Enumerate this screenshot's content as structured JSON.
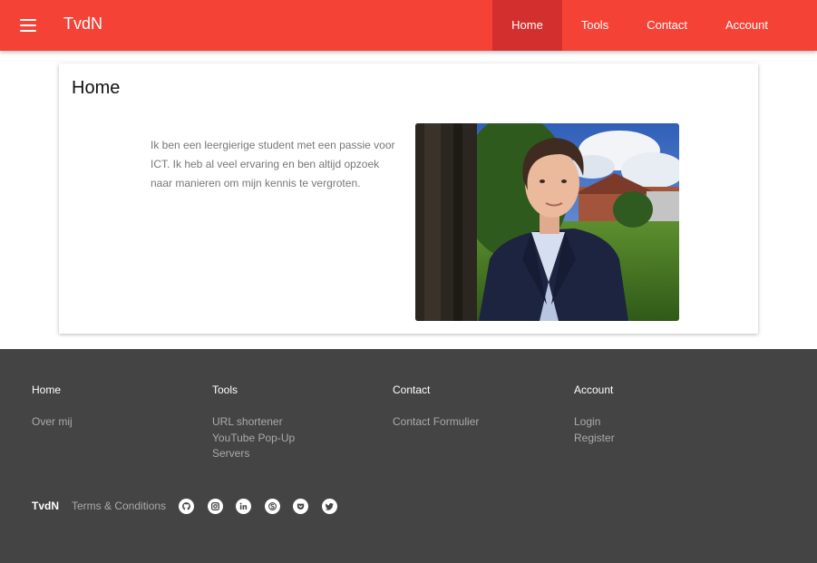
{
  "header": {
    "brand": "TvdN",
    "nav": [
      {
        "label": "Home",
        "active": true
      },
      {
        "label": "Tools",
        "active": false
      },
      {
        "label": "Contact",
        "active": false
      },
      {
        "label": "Account",
        "active": false
      }
    ]
  },
  "main": {
    "title": "Home",
    "intro": "Ik ben een leergierige student met een passie voor ICT. Ik heb al veel ervaring en ben altijd opzoek naar manieren om mijn kennis te vergroten."
  },
  "footer": {
    "columns": [
      {
        "heading": "Home",
        "links": [
          "Over mij"
        ]
      },
      {
        "heading": "Tools",
        "links": [
          "URL shortener",
          "YouTube Pop-Up",
          "Servers"
        ]
      },
      {
        "heading": "Contact",
        "links": [
          "Contact Formulier"
        ]
      },
      {
        "heading": "Account",
        "links": [
          "Login",
          "Register"
        ]
      }
    ],
    "brand": "TvdN",
    "terms": "Terms & Conditions",
    "social_icons": [
      "github-icon",
      "instagram-icon",
      "linkedin-icon",
      "skype-icon",
      "pocket-icon",
      "twitter-icon"
    ]
  },
  "colors": {
    "primary": "#f44336",
    "primary_dark": "#d32f2f",
    "footer_bg": "#444444"
  }
}
